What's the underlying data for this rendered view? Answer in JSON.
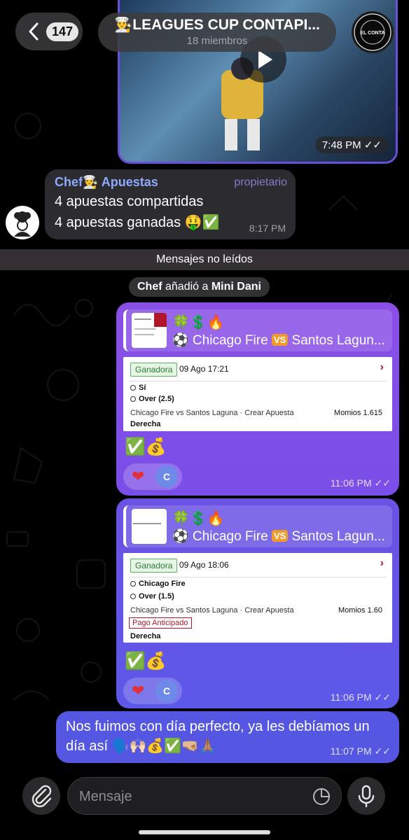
{
  "header": {
    "back_count": "147",
    "title": "👨‍🍳LEAGUES CUP CONTAPI...",
    "subtitle": "18 miembros",
    "avatar_text": "EL CONTA"
  },
  "video": {
    "time": "7:48 PM"
  },
  "incoming": {
    "sender": "Chef👨‍🍳 Apuestas",
    "role": "propietario",
    "line1": "4 apuestas compartidas",
    "line2": "4 apuestas ganadas 🤑✅",
    "time": "8:17 PM"
  },
  "unread_label": "Mensajes no leídos",
  "service": {
    "actor": "Chef",
    "action": " añadió a ",
    "target": "Mini Dani"
  },
  "bet1": {
    "preview_emoji": "🍀💲🔥",
    "preview_title_a": "⚽️ Chicago Fire ",
    "vs": "VS",
    "preview_title_b": " Santos Lagun...",
    "badge": "Ganadora",
    "date": "09 Ago 17:21",
    "pick1": "Sí",
    "pick2": "Over (2.5)",
    "match": "Chicago Fire vs Santos Laguna · Crear Apuesta",
    "momios": "Momios 1.615",
    "derecha": "Derecha",
    "emoji": "✅💰",
    "reaction_avatar": "C",
    "time": "11:06 PM"
  },
  "bet2": {
    "preview_emoji": "🍀💲🔥",
    "preview_title_a": "⚽️ Chicago Fire ",
    "vs": "VS",
    "preview_title_b": " Santos Lagun...",
    "badge": "Ganadora",
    "date": "09 Ago 18:06",
    "pick1": "Chicago Fire",
    "pick2": "Over (1.5)",
    "match": "Chicago Fire vs Santos Laguna · Crear Apuesta",
    "momios": "Momios 1.60",
    "tag": "Pago Anticipado",
    "derecha": "Derecha",
    "emoji": "✅💰",
    "reaction_avatar": "C",
    "time": "11:06 PM"
  },
  "last_message": {
    "text": "Nos fuimos con día perfecto, ya les debíamos un día así 🗣️🙌🏻💰✅🤜🏼🙏🏽",
    "time": "11:07 PM"
  },
  "composer": {
    "placeholder": "Mensaje"
  }
}
